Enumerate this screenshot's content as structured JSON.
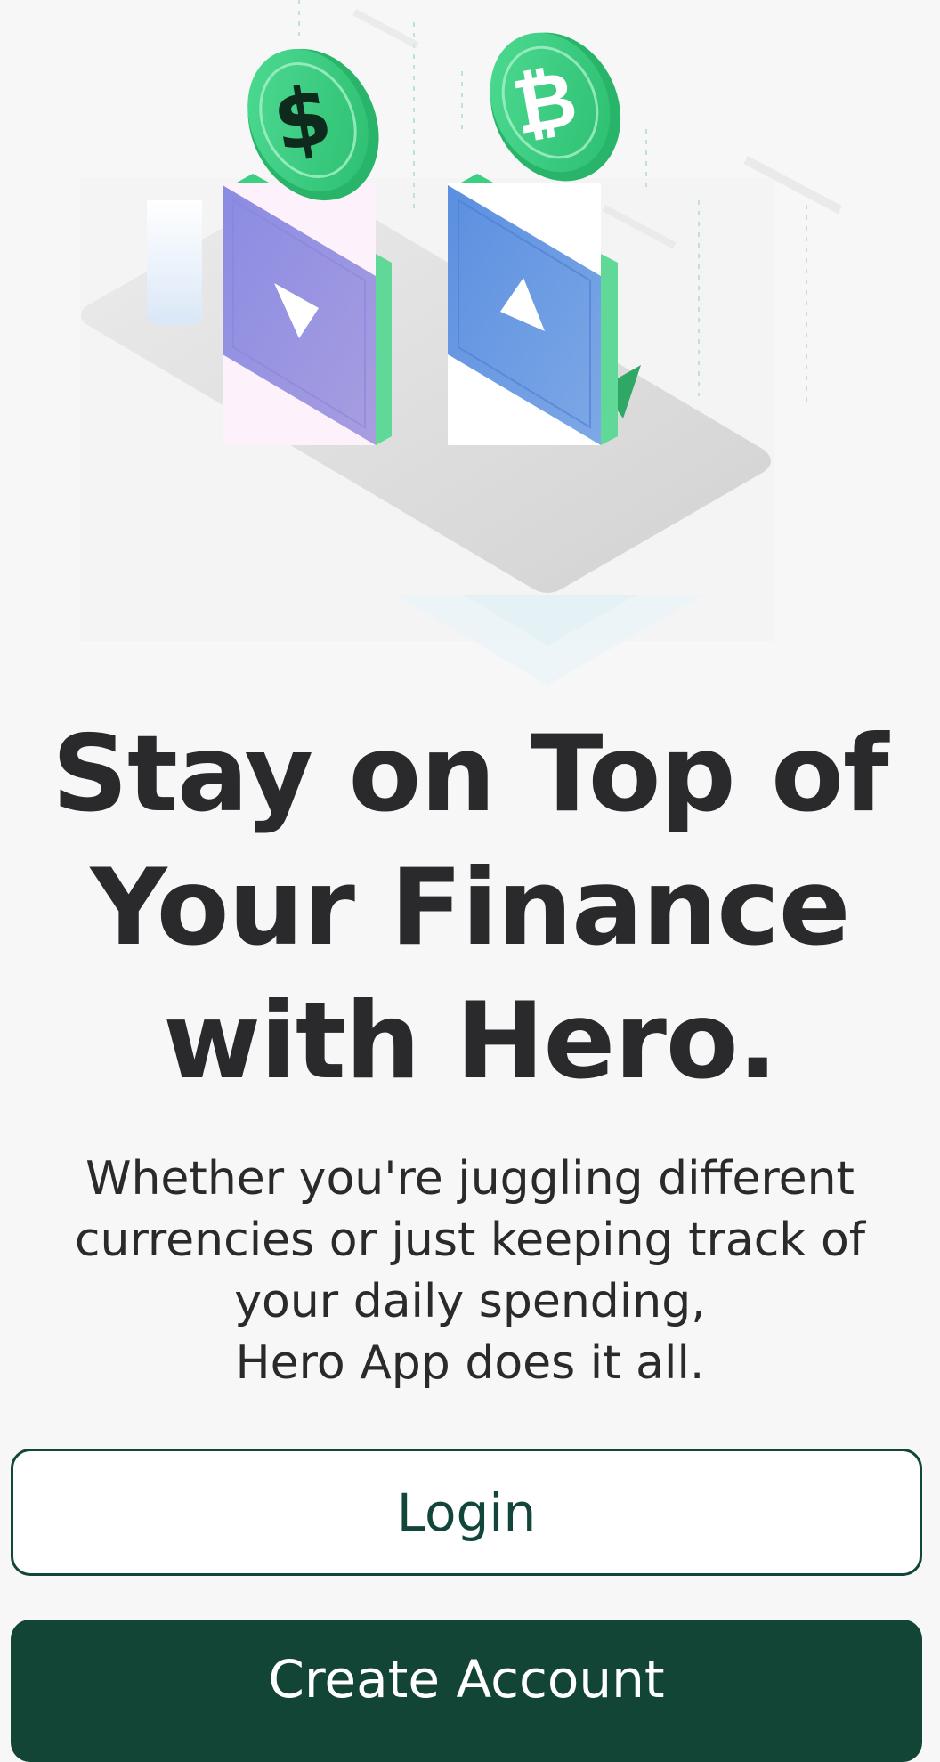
{
  "headline": {
    "line1": "Stay on Top of",
    "line2": "Your Finance",
    "line3": "with Hero."
  },
  "subtitle": {
    "line1": "Whether you're juggling different",
    "line2": "currencies or just keeping track of",
    "line3": "your daily spending,",
    "line4": "Hero App does it all."
  },
  "buttons": {
    "login_label": "Login",
    "create_label": "Create Account"
  },
  "illustration": {
    "coin_left_symbol": "$",
    "coin_right_symbol": "₿",
    "icons": [
      "dollar-coin-icon",
      "bitcoin-coin-icon",
      "down-arrow-icon",
      "up-arrow-icon"
    ]
  },
  "colors": {
    "brand_dark_green": "#124535",
    "coin_green": "#3ccf82",
    "background": "#f7f7f7",
    "text_dark": "#2a2a2c"
  }
}
